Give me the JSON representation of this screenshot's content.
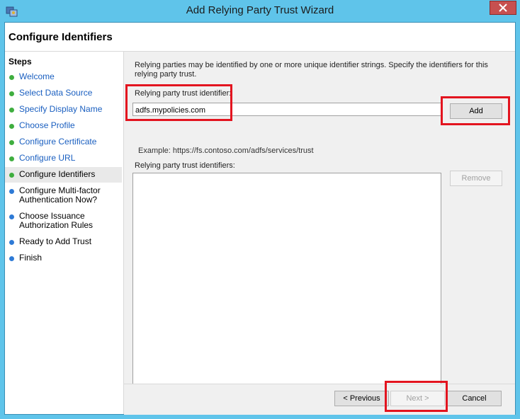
{
  "window": {
    "title": "Add Relying Party Trust Wizard",
    "icons": {
      "app": "wizard-app-icon",
      "close": "close-icon"
    },
    "colors": {
      "frame": "#5fc4ea",
      "close_button": "#c7504f",
      "highlight_box": "#e3141f"
    }
  },
  "page": {
    "title": "Configure Identifiers"
  },
  "steps": {
    "heading": "Steps",
    "items": [
      {
        "label": "Welcome",
        "status": "done"
      },
      {
        "label": "Select Data Source",
        "status": "done"
      },
      {
        "label": "Specify Display Name",
        "status": "done"
      },
      {
        "label": "Choose Profile",
        "status": "done"
      },
      {
        "label": "Configure Certificate",
        "status": "done"
      },
      {
        "label": "Configure URL",
        "status": "done"
      },
      {
        "label": "Configure Identifiers",
        "status": "current"
      },
      {
        "label": "Configure Multi-factor Authentication Now?",
        "status": "pending"
      },
      {
        "label": "Choose Issuance Authorization Rules",
        "status": "pending"
      },
      {
        "label": "Ready to Add Trust",
        "status": "pending"
      },
      {
        "label": "Finish",
        "status": "pending"
      }
    ]
  },
  "main": {
    "description": "Relying parties may be identified by one or more unique identifier strings. Specify the identifiers for this relying party trust.",
    "identifier_label": "Relying party trust identifier:",
    "identifier_value": "adfs.mypolicies.com",
    "add_label": "Add",
    "example": "Example: https://fs.contoso.com/adfs/services/trust",
    "identifiers_label": "Relying party trust identifiers:",
    "identifiers": [],
    "remove_label": "Remove"
  },
  "footer": {
    "previous_label": "< Previous",
    "next_label": "Next >",
    "cancel_label": "Cancel"
  }
}
